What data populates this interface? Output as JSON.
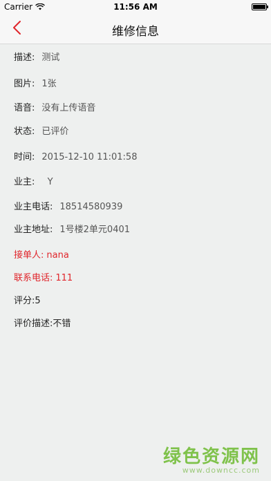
{
  "status_bar": {
    "carrier": "Carrier",
    "time": "11:56 AM"
  },
  "nav": {
    "title": "维修信息"
  },
  "details": [
    {
      "label": "描述:",
      "value": "测试"
    },
    {
      "label": "图片:",
      "value": "1张"
    },
    {
      "label": "语音:",
      "value": "没有上传语音"
    },
    {
      "label": "状态:",
      "value": "已评价"
    },
    {
      "label": "时间:",
      "value": "2015-12-10 11:01:58"
    },
    {
      "label": "业主:",
      "value": "  Y"
    },
    {
      "label": "业主电话:",
      "value": "18514580939"
    },
    {
      "label": "业主地址:",
      "value": "1号楼2单元0401"
    },
    {
      "label": "接单人:",
      "value": "nana"
    },
    {
      "label": "联系电话:",
      "value": "111"
    },
    {
      "label": "评分:",
      "value": "5"
    },
    {
      "label": "评价描述:",
      "value": "不错"
    }
  ],
  "watermark": {
    "title": "绿色资源网",
    "url": "www.downcc.com"
  },
  "colors": {
    "accent_red": "#e0252b",
    "watermark_green": "#7fc24b"
  }
}
